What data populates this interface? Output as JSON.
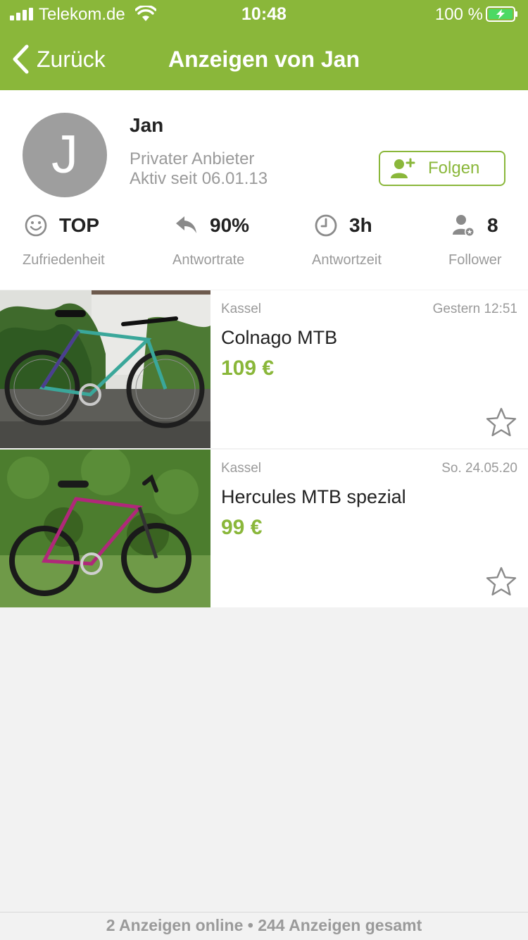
{
  "status_bar": {
    "carrier": "Telekom.de",
    "time": "10:48",
    "battery": "100 %"
  },
  "nav": {
    "back_label": "Zurück",
    "title": "Anzeigen von Jan"
  },
  "profile": {
    "avatar_letter": "J",
    "name": "Jan",
    "seller_type": "Privater Anbieter",
    "active_since": "Aktiv seit 06.01.13",
    "follow_label": "Folgen"
  },
  "stats": [
    {
      "icon": "smiley-icon",
      "value": "TOP",
      "label": "Zufriedenheit"
    },
    {
      "icon": "reply-icon",
      "value": "90%",
      "label": "Antwortrate"
    },
    {
      "icon": "clock-icon",
      "value": "3h",
      "label": "Antwortzeit"
    },
    {
      "icon": "follower-icon",
      "value": "8",
      "label": "Follower"
    }
  ],
  "listings": [
    {
      "location": "Kassel",
      "date": "Gestern 12:51",
      "title": "Colnago MTB",
      "price": "109 €"
    },
    {
      "location": "Kassel",
      "date": "So. 24.05.20",
      "title": "Hercules MTB spezial",
      "price": "99 €"
    }
  ],
  "footer": "2 Anzeigen online • 244 Anzeigen gesamt",
  "colors": {
    "accent": "#8ab73a",
    "muted": "#9a9a9a",
    "background": "#f2f2f2"
  }
}
